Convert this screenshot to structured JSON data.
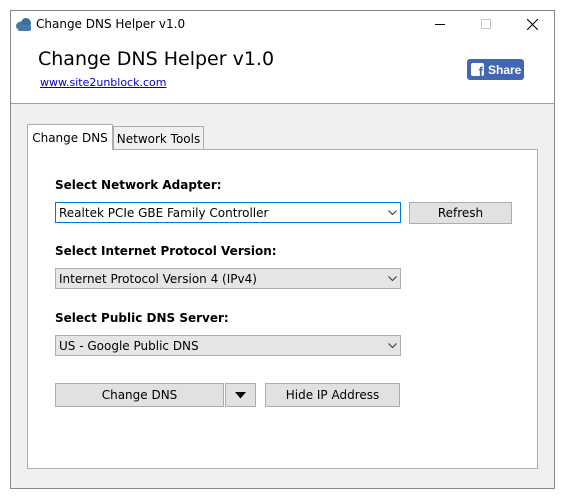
{
  "window": {
    "title": "Change DNS Helper v1.0",
    "controls": {
      "minimize": "minimize",
      "maximize": "maximize",
      "close": "close"
    }
  },
  "header": {
    "heading": "Change DNS Helper v1.0",
    "link": "www.site2unblock.com",
    "share_label": "Share",
    "share_color": "#4267b2"
  },
  "tabs": [
    {
      "label": "Change DNS",
      "active": true
    },
    {
      "label": "Network Tools",
      "active": false
    }
  ],
  "form": {
    "adapter_label": "Select Network Adapter:",
    "adapter_value": "Realtek PCIe GBE Family Controller",
    "refresh_label": "Refresh",
    "protocol_label": "Select Internet Protocol Version:",
    "protocol_value": "Internet Protocol Version 4 (IPv4)",
    "dns_label": "Select Public DNS Server:",
    "dns_value": "US - Google Public DNS",
    "change_dns_label": "Change DNS",
    "hide_ip_label": "Hide IP Address"
  },
  "icons": {
    "app": "cloud-app-icon",
    "dropdown": "chevron-down-icon",
    "facebook": "facebook-icon"
  }
}
